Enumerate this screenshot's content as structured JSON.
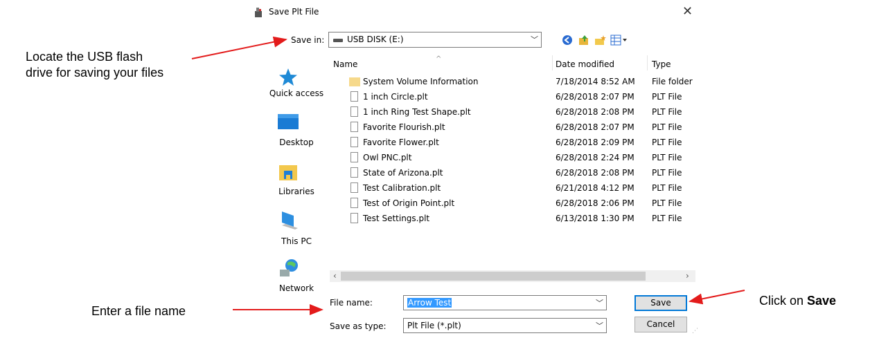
{
  "dialog": {
    "title": "Save Plt File",
    "save_in_label": "Save in:",
    "save_in_value": "USB DISK (E:)",
    "places": [
      {
        "label": "Quick access",
        "icon": "star-icon"
      },
      {
        "label": "Desktop",
        "icon": "desktop-icon"
      },
      {
        "label": "Libraries",
        "icon": "libraries-icon"
      },
      {
        "label": "This PC",
        "icon": "computer-icon"
      },
      {
        "label": "Network",
        "icon": "network-icon"
      }
    ],
    "columns": {
      "name": "Name",
      "date": "Date modified",
      "type": "Type"
    },
    "files": [
      {
        "name": "System Volume Information",
        "date": "7/18/2014 8:52 AM",
        "type": "File folder",
        "kind": "folder"
      },
      {
        "name": "1 inch Circle.plt",
        "date": "6/28/2018 2:07 PM",
        "type": "PLT File",
        "kind": "file"
      },
      {
        "name": "1 inch Ring Test Shape.plt",
        "date": "6/28/2018 2:08 PM",
        "type": "PLT File",
        "kind": "file"
      },
      {
        "name": "Favorite Flourish.plt",
        "date": "6/28/2018 2:07 PM",
        "type": "PLT File",
        "kind": "file"
      },
      {
        "name": "Favorite Flower.plt",
        "date": "6/28/2018 2:09 PM",
        "type": "PLT File",
        "kind": "file"
      },
      {
        "name": "Owl PNC.plt",
        "date": "6/28/2018 2:24 PM",
        "type": "PLT File",
        "kind": "file"
      },
      {
        "name": "State of Arizona.plt",
        "date": "6/28/2018 2:08 PM",
        "type": "PLT File",
        "kind": "file"
      },
      {
        "name": "Test Calibration.plt",
        "date": "6/21/2018 4:12 PM",
        "type": "PLT File",
        "kind": "file"
      },
      {
        "name": "Test of Origin Point.plt",
        "date": "6/28/2018 2:06 PM",
        "type": "PLT File",
        "kind": "file"
      },
      {
        "name": "Test Settings.plt",
        "date": "6/13/2018 1:30 PM",
        "type": "PLT File",
        "kind": "file"
      }
    ],
    "file_name_label": "File name:",
    "file_name_value": "Arrow Test",
    "save_as_type_label": "Save as type:",
    "save_as_type_value": "Plt File (*.plt)",
    "save_button": "Save",
    "cancel_button": "Cancel"
  },
  "annotations": {
    "locate_line1": "Locate the USB flash",
    "locate_line2": "drive for saving your files",
    "enter_name": "Enter a file name",
    "click_on": "Click on ",
    "click_bold": "Save"
  },
  "colors": {
    "arrow": "#e31b1b",
    "selection": "#3399ff",
    "default_button_border": "#0078d7"
  }
}
